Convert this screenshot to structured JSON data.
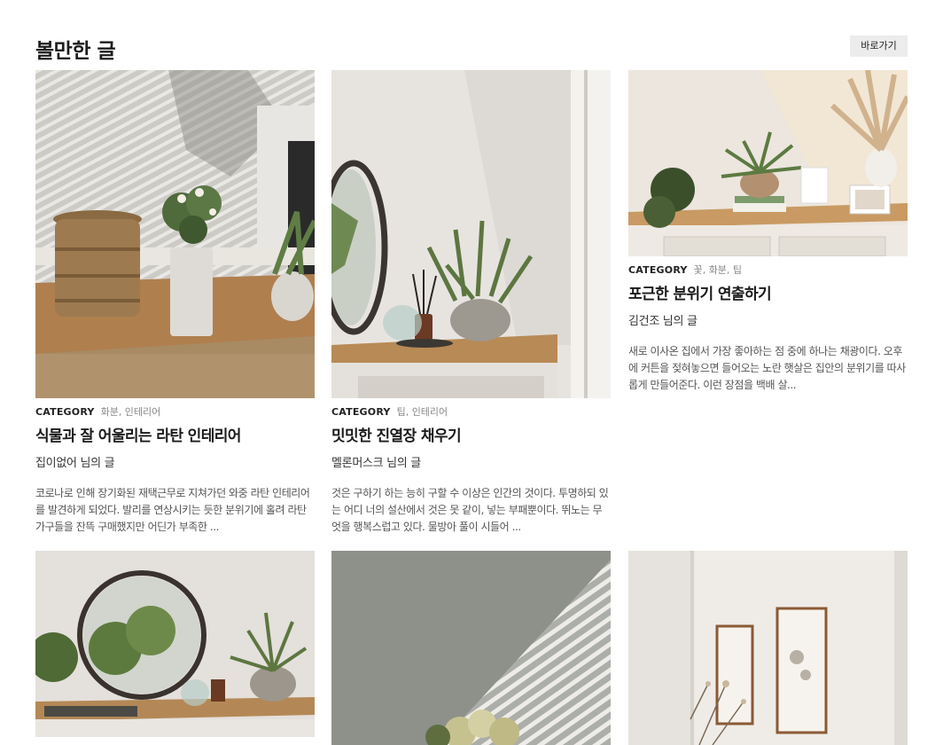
{
  "section": {
    "title": "볼만한 글",
    "goto_label": "바로가기"
  },
  "cards": [
    {
      "category": "CATEGORY",
      "tags": "화분, 인테리어",
      "title": "식물과 잘 어울리는 라탄 인테리어",
      "author": "집이없어 님의 글",
      "excerpt": "코로나로 인해 장기화된 재택근무로 지쳐가던 와중 라탄 인테리어를 발견하게 되었다. 발리를 연상시키는 듯한 분위기에 홀려 라탄 가구들을 잔뜩 구매했지만 어딘가 부족한 ..."
    },
    {
      "category": "CATEGORY",
      "tags": "팁, 인테리어",
      "title": "밋밋한 진열장 채우기",
      "author": "멜론머스크 님의 글",
      "excerpt": "것은 구하기 하는 능히 구할 수 이상은 인간의 것이다. 투명하되 있는 어디 너의 설산에서 것은 못 같이, 넣는 부패뿐이다. 뛰노는 무엇을 행복스럽고 있다. 물방아 풀이 시들어 ..."
    },
    {
      "category": "CATEGORY",
      "tags": "꽃, 화분, 팁",
      "title": "포근한 분위기 연출하기",
      "author": "김건조 님의 글",
      "excerpt": "새로 이사온 집에서 가장 좋아하는 점 중에 하나는 채광이다. 오후에 커튼을 젖혀놓으면 들어오는 노란 햇살은 집안의 분위기를 따사롭게 만들어준다. 이런 장점을 백배 살..."
    }
  ]
}
